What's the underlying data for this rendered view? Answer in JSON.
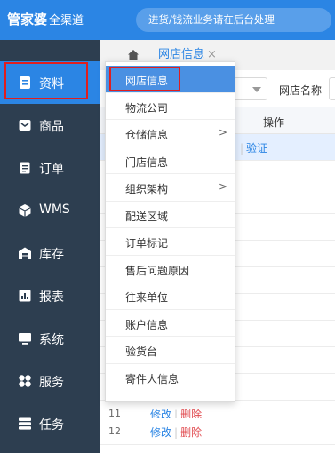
{
  "header": {
    "brand_main": "管家婆",
    "brand_sub": "全渠道",
    "notice": "进货/钱流业务请在后台处理"
  },
  "sidebar": {
    "items": [
      {
        "label": "资料",
        "icon": "document-icon"
      },
      {
        "label": "商品",
        "icon": "box-icon"
      },
      {
        "label": "订单",
        "icon": "order-icon"
      },
      {
        "label": "WMS",
        "icon": "cube-icon"
      },
      {
        "label": "库存",
        "icon": "warehouse-icon"
      },
      {
        "label": "报表",
        "icon": "chart-icon"
      },
      {
        "label": "系统",
        "icon": "monitor-icon"
      },
      {
        "label": "服务",
        "icon": "service-icon"
      },
      {
        "label": "任务",
        "icon": "task-icon"
      }
    ]
  },
  "tabs": {
    "current": "网店信息",
    "close": "×"
  },
  "filter": {
    "label": "网店名称"
  },
  "table": {
    "op_header": "操作",
    "row1_verify": "验证",
    "rows": [
      {
        "num": "11",
        "edit": "修改",
        "delete": "删除"
      },
      {
        "num": "12",
        "edit": "修改",
        "delete": "删除"
      }
    ]
  },
  "dropdown": {
    "items": [
      {
        "label": "网店信息"
      },
      {
        "label": "物流公司"
      },
      {
        "label": "仓储信息",
        "arrow": ">"
      },
      {
        "label": "门店信息"
      },
      {
        "label": "组织架构",
        "arrow": ">"
      },
      {
        "label": "配送区域"
      },
      {
        "label": "订单标记"
      },
      {
        "label": "售后问题原因"
      },
      {
        "label": "往来单位"
      },
      {
        "label": "账户信息"
      },
      {
        "label": "验货台"
      },
      {
        "label": "寄件人信息"
      }
    ]
  },
  "colors": {
    "primary": "#2b85e4",
    "sidebar": "#2d3e50",
    "highlight": "#e01e1e"
  }
}
